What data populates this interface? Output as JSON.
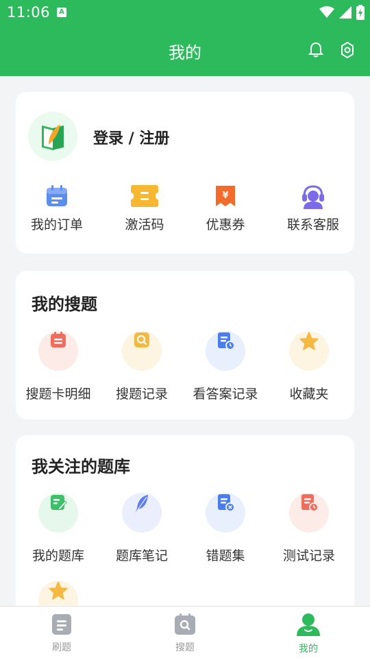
{
  "status_bar": {
    "time": "11:06",
    "a_badge": "A"
  },
  "header": {
    "title": "我的",
    "bell_icon": "bell-icon",
    "settings_icon": "gear-icon",
    "bg_color": "#2dba5c"
  },
  "profile": {
    "login_label": "登录 / 注册",
    "quick_links": [
      {
        "label": "我的订单",
        "icon": "calendar-icon",
        "color": "#5b8def"
      },
      {
        "label": "激活码",
        "icon": "ticket-icon",
        "color": "#f7b731"
      },
      {
        "label": "优惠券",
        "icon": "coupon-icon",
        "color": "#f26b2b"
      },
      {
        "label": "联系客服",
        "icon": "headset-icon",
        "color": "#7b6be8"
      }
    ]
  },
  "search_section": {
    "title": "我的搜题",
    "items": [
      {
        "label": "搜题卡明细",
        "icon": "card-detail-icon",
        "color": "#f26b5b"
      },
      {
        "label": "搜题记录",
        "icon": "search-record-icon",
        "color": "#f5b840"
      },
      {
        "label": "看答案记录",
        "icon": "answer-record-icon",
        "color": "#4a7df0"
      },
      {
        "label": "收藏夹",
        "icon": "star-icon",
        "color": "#f5b840"
      }
    ]
  },
  "bank_section": {
    "title": "我关注的题库",
    "items": [
      {
        "label": "我的题库",
        "icon": "edit-doc-icon",
        "color": "#3cc06a"
      },
      {
        "label": "题库笔记",
        "icon": "feather-icon",
        "color": "#5b7cf0"
      },
      {
        "label": "错题集",
        "icon": "wrong-doc-icon",
        "color": "#4a7df0"
      },
      {
        "label": "测试记录",
        "icon": "test-record-icon",
        "color": "#f26b5b"
      }
    ],
    "partial_item": {
      "icon": "star-icon"
    }
  },
  "tabbar": {
    "tabs": [
      {
        "label": "刷题",
        "icon": "document-icon",
        "active": false
      },
      {
        "label": "搜题",
        "icon": "search-doc-icon",
        "active": false
      },
      {
        "label": "我的",
        "icon": "user-icon",
        "active": true
      }
    ]
  }
}
